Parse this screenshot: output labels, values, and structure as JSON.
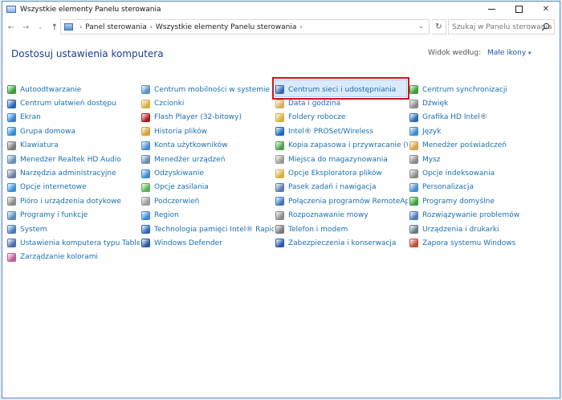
{
  "window": {
    "title": "Wszystkie elementy Panelu sterowania"
  },
  "address": {
    "crumbs": [
      "Panel sterowania",
      "Wszystkie elementy Panelu sterowania"
    ]
  },
  "search": {
    "placeholder": "Szukaj w Panelu sterowania"
  },
  "heading": "Dostosuj ustawienia komputera",
  "view_by": {
    "label": "Widok według:",
    "value": "Małe ikony"
  },
  "highlighted_item": "Centrum sieci i udostępniania",
  "columns": [
    [
      {
        "label": "Autoodtwarzanie",
        "color": "#3a9b3a"
      },
      {
        "label": "Centrum ułatwień dostępu",
        "color": "#2a5fb8"
      },
      {
        "label": "Ekran",
        "color": "#3a7fd0"
      },
      {
        "label": "Grupa domowa",
        "color": "#2d8fd6"
      },
      {
        "label": "Klawiatura",
        "color": "#7a7a7a"
      },
      {
        "label": "Menedżer Realtek HD Audio",
        "color": "#6a8fb8"
      },
      {
        "label": "Narzędzia administracyjne",
        "color": "#6a7fa0"
      },
      {
        "label": "Opcje internetowe",
        "color": "#3a8fd8"
      },
      {
        "label": "Pióro i urządzenia dotykowe",
        "color": "#8a8a8a"
      },
      {
        "label": "Programy i funkcje",
        "color": "#5a8ab8"
      },
      {
        "label": "System",
        "color": "#4a7ab8"
      },
      {
        "label": "Ustawienia komputera typu Tablet",
        "color": "#4a6fa8"
      },
      {
        "label": "Zarządzanie kolorami",
        "color": "#c05a9a"
      }
    ],
    [
      {
        "label": "Centrum mobilności w systemie Win...",
        "color": "#5a8fc8"
      },
      {
        "label": "Czcionki",
        "color": "#d8b040"
      },
      {
        "label": "Flash Player (32-bitowy)",
        "color": "#b01a1a"
      },
      {
        "label": "Historia plików",
        "color": "#d8a030"
      },
      {
        "label": "Konta użytkowników",
        "color": "#4a8ad0"
      },
      {
        "label": "Menedżer urządzeń",
        "color": "#6a8ab0"
      },
      {
        "label": "Odzyskiwanie",
        "color": "#3a8ad0"
      },
      {
        "label": "Opcje zasilania",
        "color": "#5ab05a"
      },
      {
        "label": "Podczerwień",
        "color": "#9a9a9a"
      },
      {
        "label": "Region",
        "color": "#3a8ad8"
      },
      {
        "label": "Technologia pamięci Intel® Rapid",
        "color": "#2a6ab8"
      },
      {
        "label": "Windows Defender",
        "color": "#2a5aa8"
      }
    ],
    [
      {
        "label": "Centrum sieci i udostępniania",
        "color": "#3a6ab8"
      },
      {
        "label": "Data i godzina",
        "color": "#d8b060"
      },
      {
        "label": "Foldery robocze",
        "color": "#d8b040"
      },
      {
        "label": "Intel® PROSet/Wireless",
        "color": "#1a6ab8"
      },
      {
        "label": "Kopia zapasowa i przywracanie (Win...",
        "color": "#4aa04a"
      },
      {
        "label": "Miejsca do magazynowania",
        "color": "#9a9a9a"
      },
      {
        "label": "Opcje Eksploratora plików",
        "color": "#d8b040"
      },
      {
        "label": "Pasek zadań i nawigacja",
        "color": "#5a7ab0"
      },
      {
        "label": "Połączenia programów RemoteApp i ...",
        "color": "#3a7ac8"
      },
      {
        "label": "Rozpoznawanie mowy",
        "color": "#8a8a8a"
      },
      {
        "label": "Telefon i modem",
        "color": "#7a7a7a"
      },
      {
        "label": "Zabezpieczenia i konserwacja",
        "color": "#2a5ab0"
      }
    ],
    [
      {
        "label": "Centrum synchronizacji",
        "color": "#3aa03a"
      },
      {
        "label": "Dźwięk",
        "color": "#8a8a8a"
      },
      {
        "label": "Grafika HD Intel®",
        "color": "#2a6ab8"
      },
      {
        "label": "Język",
        "color": "#3a8ad0"
      },
      {
        "label": "Menedżer poświadczeń",
        "color": "#d8a040"
      },
      {
        "label": "Mysz",
        "color": "#8a8a8a"
      },
      {
        "label": "Opcje indeksowania",
        "color": "#8a8a8a"
      },
      {
        "label": "Personalizacja",
        "color": "#4a8ad0"
      },
      {
        "label": "Programy domyślne",
        "color": "#3aa03a"
      },
      {
        "label": "Rozwiązywanie problemów",
        "color": "#4a7ab8"
      },
      {
        "label": "Urządzenia i drukarki",
        "color": "#6a7a8a"
      },
      {
        "label": "Zapora systemu Windows",
        "color": "#c04a3a"
      }
    ]
  ]
}
